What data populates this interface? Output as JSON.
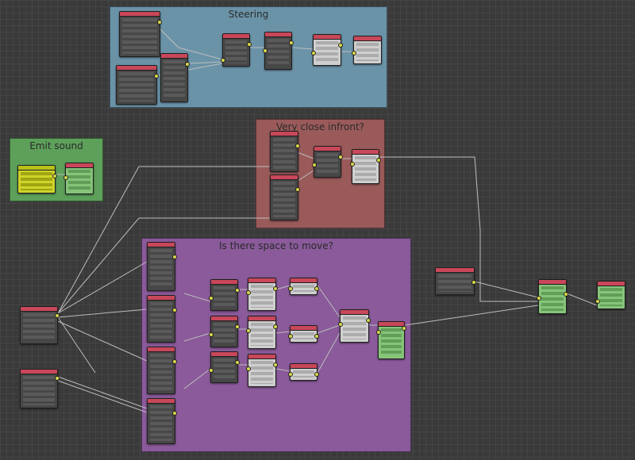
{
  "frames": {
    "steering": {
      "title": "Steering"
    },
    "very_close": {
      "title": "Very close infront?"
    },
    "emit_sound": {
      "title": "Emit sound"
    },
    "space_to_move": {
      "title": "Is there space to move?"
    }
  },
  "colors": {
    "background": "#3a3a3a",
    "grid": "#444444",
    "steering_frame": "#6b93a8",
    "close_frame": "#9a5a5a",
    "emit_frame": "#5da05a",
    "space_frame": "#8a5a9a",
    "node_header": "#c9475a",
    "wire": "#bdbdbd"
  }
}
